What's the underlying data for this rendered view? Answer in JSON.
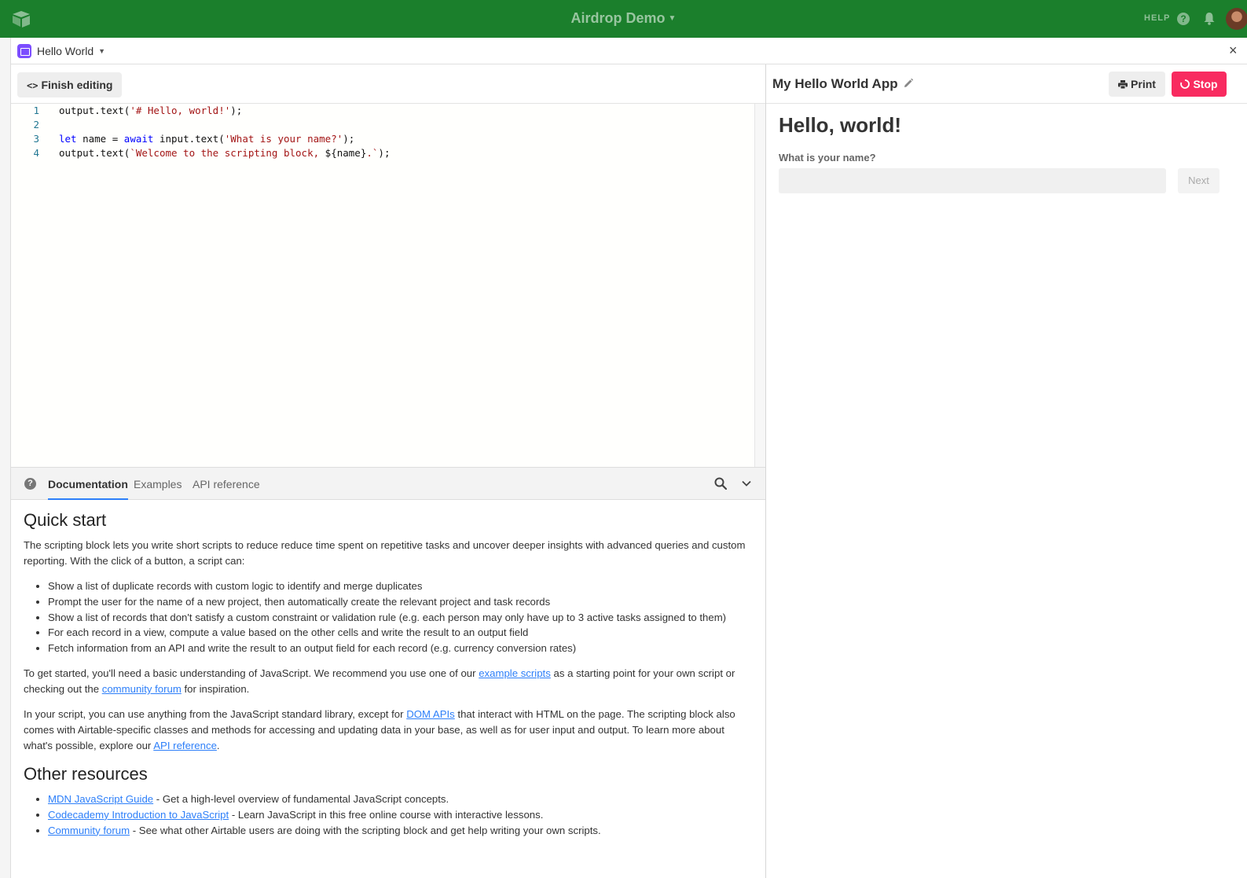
{
  "topbar": {
    "base_title": "Airdrop Demo",
    "help_label": "HELP",
    "help_icon_glyph": "?"
  },
  "modal": {
    "block_name": "Hello World",
    "close_glyph": "×"
  },
  "editor": {
    "finish_label": "Finish editing",
    "lines": [
      {
        "n": "1",
        "parts": [
          [
            "",
            "output.text("
          ],
          [
            "str",
            "'# Hello, world!'"
          ],
          [
            "",
            ");"
          ]
        ]
      },
      {
        "n": "2",
        "parts": []
      },
      {
        "n": "3",
        "parts": [
          [
            "kw",
            "let"
          ],
          [
            "",
            " name = "
          ],
          [
            "kw",
            "await"
          ],
          [
            "",
            " input.text("
          ],
          [
            "str",
            "'What is your name?'"
          ],
          [
            "",
            ");"
          ]
        ]
      },
      {
        "n": "4",
        "parts": [
          [
            "",
            "output.text("
          ],
          [
            "str",
            "`Welcome to the scripting block, "
          ],
          [
            "",
            "${name}"
          ],
          [
            "str",
            ".`"
          ],
          [
            "",
            ");"
          ]
        ]
      }
    ]
  },
  "docs": {
    "help_glyph": "?",
    "tabs": [
      "Documentation",
      "Examples",
      "API reference"
    ],
    "quick_start_title": "Quick start",
    "intro": "The scripting block lets you write short scripts to reduce reduce time spent on repetitive tasks and uncover deeper insights with advanced queries and custom reporting. With the click of a button, a script can:",
    "bullets": [
      "Show a list of duplicate records with custom logic to identify and merge duplicates",
      "Prompt the user for the name of a new project, then automatically create the relevant project and task records",
      "Show a list of records that don't satisfy a custom constraint or validation rule (e.g. each person may only have up to 3 active tasks assigned to them)",
      "For each record in a view, compute a value based on the other cells and write the result to an output field",
      "Fetch information from an API and write the result to an output field for each record (e.g. currency conversion rates)"
    ],
    "p2_a": "To get started, you'll need a basic understanding of JavaScript. We recommend you use one of our ",
    "p2_link1": "example scripts",
    "p2_b": " as a starting point for your own script or checking out the ",
    "p2_link2": "community forum",
    "p2_c": " for inspiration.",
    "p3_a": "In your script, you can use anything from the JavaScript standard library, except for ",
    "p3_link1": "DOM APIs",
    "p3_b": " that interact with HTML on the page. The scripting block also comes with Airtable-specific classes and methods for accessing and updating data in your base, as well as for user input and output. To learn more about what's possible, explore our ",
    "p3_link2": "API reference",
    "p3_c": ".",
    "other_title": "Other resources",
    "resources": [
      {
        "link": "MDN JavaScript Guide",
        "text": " - Get a high-level overview of fundamental JavaScript concepts."
      },
      {
        "link": "Codecademy Introduction to JavaScript",
        "text": " - Learn JavaScript in this free online course with interactive lessons."
      },
      {
        "link": "Community forum",
        "text": " - See what other Airtable users are doing with the scripting block and get help writing your own scripts."
      }
    ]
  },
  "app": {
    "title": "My Hello World App",
    "print_label": "Print",
    "stop_label": "Stop",
    "output_heading": "Hello, world!",
    "input_label": "What is your name?",
    "input_value": "",
    "next_label": "Next"
  },
  "colors": {
    "topbar": "#1b7f2c",
    "stop_button": "#f82b60",
    "link": "#2d7ff9",
    "block_icon": "#7c4dff"
  }
}
